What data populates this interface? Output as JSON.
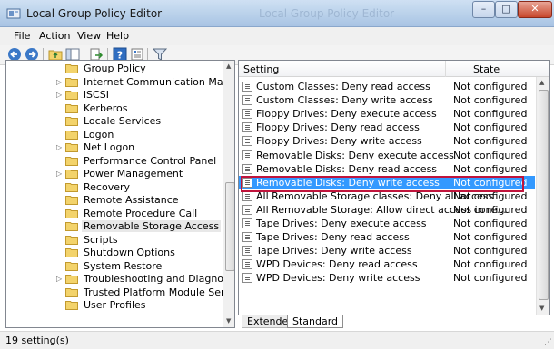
{
  "window": {
    "title": "Local Group Policy Editor",
    "ghost_title": "Local Group Policy Editor",
    "min_glyph": "–",
    "max_glyph": "□",
    "close_glyph": "✕"
  },
  "menu": [
    "File",
    "Action",
    "View",
    "Help"
  ],
  "toolbar": {
    "icons": [
      "back-icon",
      "forward-icon",
      "up-folder-icon",
      "show-hide-tree-icon",
      "export-list-icon",
      "help-icon",
      "properties-icon",
      "filter-icon"
    ]
  },
  "tree": {
    "items": [
      {
        "label": "Group Policy",
        "expandable": false
      },
      {
        "label": "Internet Communication Manageme",
        "expandable": true
      },
      {
        "label": "iSCSI",
        "expandable": true
      },
      {
        "label": "Kerberos",
        "expandable": false
      },
      {
        "label": "Locale Services",
        "expandable": false
      },
      {
        "label": "Logon",
        "expandable": false
      },
      {
        "label": "Net Logon",
        "expandable": true
      },
      {
        "label": "Performance Control Panel",
        "expandable": false
      },
      {
        "label": "Power Management",
        "expandable": true
      },
      {
        "label": "Recovery",
        "expandable": false
      },
      {
        "label": "Remote Assistance",
        "expandable": false
      },
      {
        "label": "Remote Procedure Call",
        "expandable": false
      },
      {
        "label": "Removable Storage Access",
        "expandable": false,
        "selected": true
      },
      {
        "label": "Scripts",
        "expandable": false
      },
      {
        "label": "Shutdown Options",
        "expandable": false
      },
      {
        "label": "System Restore",
        "expandable": false
      },
      {
        "label": "Troubleshooting and Diagnostics",
        "expandable": true
      },
      {
        "label": "Trusted Platform Module Services",
        "expandable": false
      },
      {
        "label": "User Profiles",
        "expandable": false
      }
    ]
  },
  "settings": {
    "columns": {
      "setting": "Setting",
      "state": "State"
    },
    "rows": [
      {
        "name": "Custom Classes: Deny read access",
        "state": "Not configured"
      },
      {
        "name": "Custom Classes: Deny write access",
        "state": "Not configured"
      },
      {
        "name": "Floppy Drives: Deny execute access",
        "state": "Not configured"
      },
      {
        "name": "Floppy Drives: Deny read access",
        "state": "Not configured"
      },
      {
        "name": "Floppy Drives: Deny write access",
        "state": "Not configured"
      },
      {
        "name": "Removable Disks: Deny execute access",
        "state": "Not configured"
      },
      {
        "name": "Removable Disks: Deny read access",
        "state": "Not configured"
      },
      {
        "name": "Removable Disks: Deny write access",
        "state": "Not configured",
        "selected": true
      },
      {
        "name": "All Removable Storage classes: Deny all access",
        "state": "Not configured"
      },
      {
        "name": "All Removable Storage: Allow direct access in re...",
        "state": "Not configured"
      },
      {
        "name": "Tape Drives: Deny execute access",
        "state": "Not configured"
      },
      {
        "name": "Tape Drives: Deny read access",
        "state": "Not configured"
      },
      {
        "name": "Tape Drives: Deny write access",
        "state": "Not configured"
      },
      {
        "name": "WPD Devices: Deny read access",
        "state": "Not configured"
      },
      {
        "name": "WPD Devices: Deny write access",
        "state": "Not configured"
      }
    ]
  },
  "tabs": [
    "Extended",
    "Standard"
  ],
  "status": {
    "text": "19 setting(s)"
  },
  "colors": {
    "selection": "#3399ff",
    "highlight_box": "#c0143c",
    "folder": "#f3d36b"
  }
}
